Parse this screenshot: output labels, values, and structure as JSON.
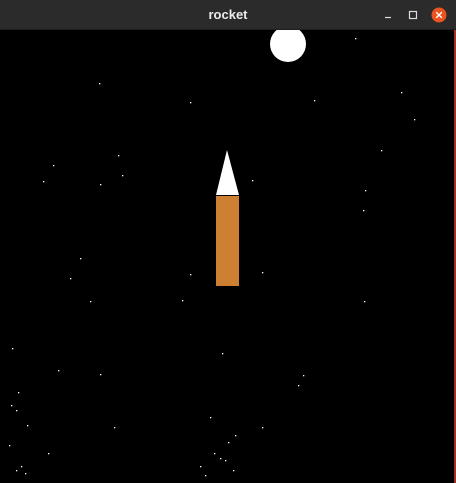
{
  "window": {
    "title": "rocket",
    "controls": {
      "minimize": "minimize-icon",
      "maximize": "maximize-icon",
      "close": "close-icon"
    },
    "close_color": "#e95420",
    "titlebar_color": "#2b2b2b"
  },
  "scene": {
    "background_color": "#000000",
    "moon_color": "#ffffff",
    "rocket": {
      "nose_color": "#ffffff",
      "body_color": "#cd7f32"
    },
    "star_color": "#ffffff"
  }
}
